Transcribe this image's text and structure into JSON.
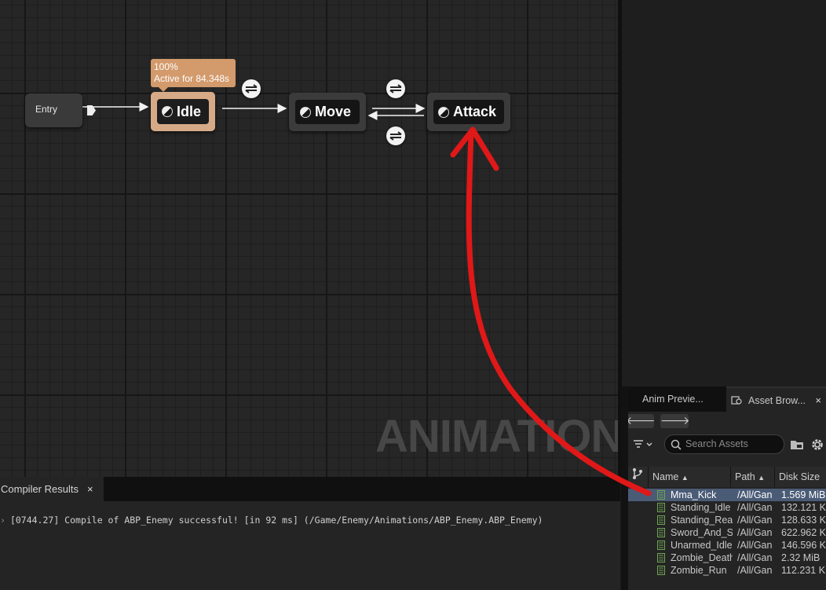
{
  "graph": {
    "entry_label": "Entry",
    "tooltip_line1": "100%",
    "tooltip_line2": "Active for 84.348s",
    "states": [
      {
        "name": "Idle"
      },
      {
        "name": "Move"
      },
      {
        "name": "Attack"
      }
    ],
    "watermark": "ANIMATION"
  },
  "right_panel": {
    "tab_anim_preview": "Anim Previe...",
    "tab_asset_browser": "Asset Brow...",
    "close_glyph": "×",
    "nav_back": "🡐",
    "nav_forward": "🡒",
    "search_placeholder": "Search Assets",
    "columns": {
      "name": "Name",
      "path": "Path",
      "disk_size": "Disk Size"
    },
    "assets": [
      {
        "name": "Mma_Kick",
        "path": "/All/Gan",
        "size": "1.569 MiB",
        "selected": true
      },
      {
        "name": "Standing_Idle",
        "path": "/All/Gan",
        "size": "132.121 K"
      },
      {
        "name": "Standing_React",
        "path": "/All/Gan",
        "size": "128.633 K"
      },
      {
        "name": "Sword_And_S",
        "path": "/All/Gan",
        "size": "622.962 K"
      },
      {
        "name": "Unarmed_Idle",
        "path": "/All/Gan",
        "size": "146.596 K"
      },
      {
        "name": "Zombie_Death",
        "path": "/All/Gan",
        "size": "2.32 MiB"
      },
      {
        "name": "Zombie_Run",
        "path": "/All/Gan",
        "size": "112.231 K"
      }
    ]
  },
  "compiler": {
    "tab_label": "Compiler Results",
    "close_glyph": "×",
    "message": "[0744.27] Compile of ABP_Enemy successful! [in 92 ms] (/Game/Enemy/Animations/ABP_Enemy.ABP_Enemy)",
    "bullet": "›"
  },
  "colors": {
    "active_state": "#d7aa87",
    "tooltip": "#d39a6c",
    "selected_row": "#4a5b76",
    "annotation_arrow": "#e01818",
    "asset_icon": "#6fa552"
  }
}
